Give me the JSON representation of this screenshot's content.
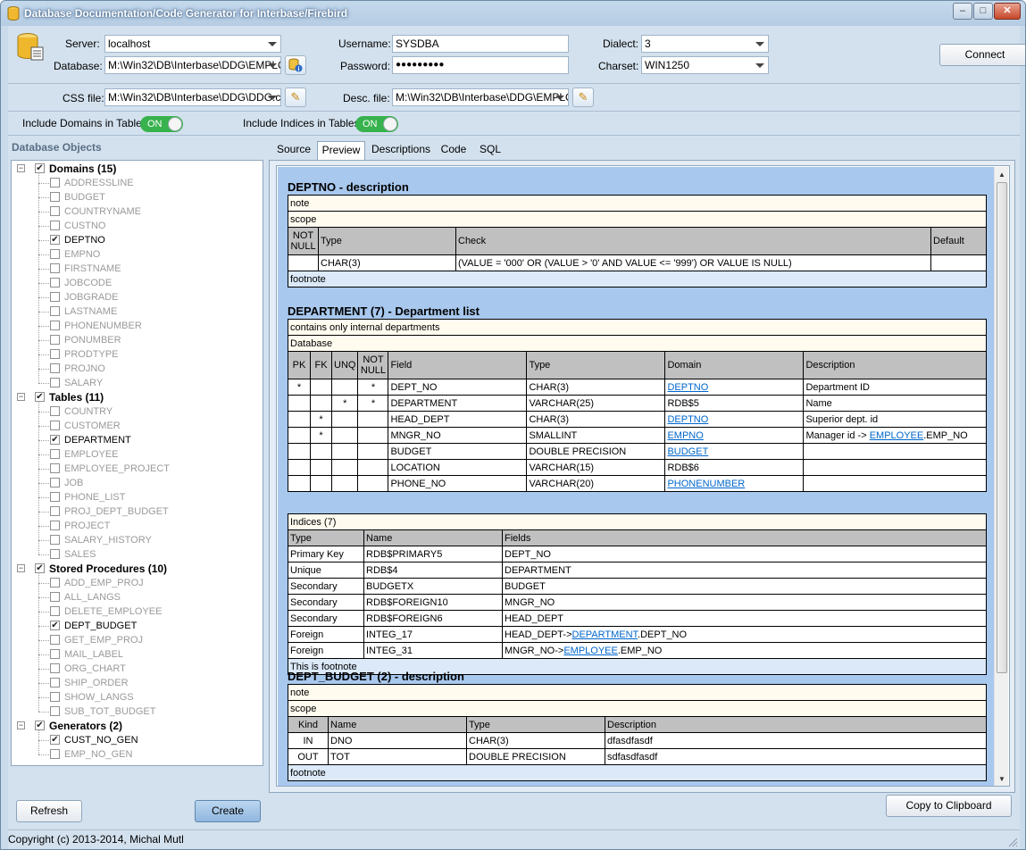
{
  "window": {
    "title": "Database Documentation/Code Generator for Interbase/Firebird",
    "min": "‒",
    "max": "□",
    "close": "✕"
  },
  "conn": {
    "server_label": "Server:",
    "server": "localhost",
    "database_label": "Database:",
    "database": "M:\\Win32\\DB\\Interbase\\DDG\\EMPLO'",
    "username_label": "Username:",
    "username": "SYSDBA",
    "password_label": "Password:",
    "password": "●●●●●●●●●",
    "dialect_label": "Dialect:",
    "dialect": "3",
    "charset_label": "Charset:",
    "charset": "WIN1250",
    "connect": "Connect"
  },
  "files": {
    "css_label": "CSS file:",
    "css": "M:\\Win32\\DB\\Interbase\\DDG\\DDG.cs",
    "desc_label": "Desc. file:",
    "desc": "M:\\Win32\\DB\\Interbase\\DDG\\EMPLO'"
  },
  "options": {
    "domains_label": "Include Domains in Tables",
    "domains_state": "ON",
    "indices_label": "Include Indices in Tables",
    "indices_state": "ON"
  },
  "objects_title": "Database Objects",
  "tree": [
    {
      "label": "Domains (15)",
      "checked": true,
      "items": [
        {
          "label": "ADDRESSLINE",
          "checked": false
        },
        {
          "label": "BUDGET",
          "checked": false
        },
        {
          "label": "COUNTRYNAME",
          "checked": false
        },
        {
          "label": "CUSTNO",
          "checked": false
        },
        {
          "label": "DEPTNO",
          "checked": true
        },
        {
          "label": "EMPNO",
          "checked": false
        },
        {
          "label": "FIRSTNAME",
          "checked": false
        },
        {
          "label": "JOBCODE",
          "checked": false
        },
        {
          "label": "JOBGRADE",
          "checked": false
        },
        {
          "label": "LASTNAME",
          "checked": false
        },
        {
          "label": "PHONENUMBER",
          "checked": false
        },
        {
          "label": "PONUMBER",
          "checked": false
        },
        {
          "label": "PRODTYPE",
          "checked": false
        },
        {
          "label": "PROJNO",
          "checked": false
        },
        {
          "label": "SALARY",
          "checked": false
        }
      ]
    },
    {
      "label": "Tables (11)",
      "checked": true,
      "items": [
        {
          "label": "COUNTRY",
          "checked": false
        },
        {
          "label": "CUSTOMER",
          "checked": false
        },
        {
          "label": "DEPARTMENT",
          "checked": true
        },
        {
          "label": "EMPLOYEE",
          "checked": false
        },
        {
          "label": "EMPLOYEE_PROJECT",
          "checked": false
        },
        {
          "label": "JOB",
          "checked": false
        },
        {
          "label": "PHONE_LIST",
          "checked": false
        },
        {
          "label": "PROJ_DEPT_BUDGET",
          "checked": false
        },
        {
          "label": "PROJECT",
          "checked": false
        },
        {
          "label": "SALARY_HISTORY",
          "checked": false
        },
        {
          "label": "SALES",
          "checked": false
        }
      ]
    },
    {
      "label": "Stored Procedures (10)",
      "checked": true,
      "items": [
        {
          "label": "ADD_EMP_PROJ",
          "checked": false
        },
        {
          "label": "ALL_LANGS",
          "checked": false
        },
        {
          "label": "DELETE_EMPLOYEE",
          "checked": false
        },
        {
          "label": "DEPT_BUDGET",
          "checked": true
        },
        {
          "label": "GET_EMP_PROJ",
          "checked": false
        },
        {
          "label": "MAIL_LABEL",
          "checked": false
        },
        {
          "label": "ORG_CHART",
          "checked": false
        },
        {
          "label": "SHIP_ORDER",
          "checked": false
        },
        {
          "label": "SHOW_LANGS",
          "checked": false
        },
        {
          "label": "SUB_TOT_BUDGET",
          "checked": false
        }
      ]
    },
    {
      "label": "Generators (2)",
      "checked": true,
      "items": [
        {
          "label": "CUST_NO_GEN",
          "checked": true
        },
        {
          "label": "EMP_NO_GEN",
          "checked": false
        }
      ]
    }
  ],
  "buttons": {
    "refresh": "Refresh",
    "create": "Create",
    "copy": "Copy to Clipboard"
  },
  "tabs": [
    "Source",
    "Preview",
    "Descriptions",
    "Code",
    "SQL"
  ],
  "doc": {
    "deptno": {
      "title": "DEPTNO - description",
      "note": "note",
      "scope": "scope",
      "headers": [
        "NOT NULL",
        "Type",
        "Check",
        "Default"
      ],
      "row": [
        "",
        "CHAR(3)",
        "(VALUE = '000' OR (VALUE > '0' AND VALUE <= '999') OR VALUE IS NULL)",
        ""
      ],
      "footnote": "footnote"
    },
    "department": {
      "title": "DEPARTMENT (7) - Department list",
      "note": "contains only internal departments",
      "scope": "Database",
      "headers": [
        "PK",
        "FK",
        "UNQ",
        "NOT NULL",
        "Field",
        "Type",
        "Domain",
        "Description"
      ],
      "rows": [
        {
          "pk": "*",
          "fk": "",
          "unq": "",
          "nn": "*",
          "field": "DEPT_NO",
          "type": "CHAR(3)",
          "domain": "DEPTNO",
          "domain_link": true,
          "desc": "Department ID"
        },
        {
          "pk": "",
          "fk": "",
          "unq": "*",
          "nn": "*",
          "field": "DEPARTMENT",
          "type": "VARCHAR(25)",
          "domain": "RDB$5",
          "domain_link": false,
          "desc": "Name"
        },
        {
          "pk": "",
          "fk": "*",
          "unq": "",
          "nn": "",
          "field": "HEAD_DEPT",
          "type": "CHAR(3)",
          "domain": "DEPTNO",
          "domain_link": true,
          "desc": "Superior dept. id"
        },
        {
          "pk": "",
          "fk": "*",
          "unq": "",
          "nn": "",
          "field": "MNGR_NO",
          "type": "SMALLINT",
          "domain": "EMPNO",
          "domain_link": true,
          "desc": "Manager id -> ",
          "desc_link": "EMPLOYEE",
          "desc_tail": ".EMP_NO"
        },
        {
          "pk": "",
          "fk": "",
          "unq": "",
          "nn": "",
          "field": "BUDGET",
          "type": "DOUBLE PRECISION",
          "domain": "BUDGET",
          "domain_link": true,
          "desc": ""
        },
        {
          "pk": "",
          "fk": "",
          "unq": "",
          "nn": "",
          "field": "LOCATION",
          "type": "VARCHAR(15)",
          "domain": "RDB$6",
          "domain_link": false,
          "desc": ""
        },
        {
          "pk": "",
          "fk": "",
          "unq": "",
          "nn": "",
          "field": "PHONE_NO",
          "type": "VARCHAR(20)",
          "domain": "PHONENUMBER",
          "domain_link": true,
          "desc": ""
        }
      ],
      "indices_label": "Indices (7)",
      "idx_headers": [
        "Type",
        "Name",
        "Fields"
      ],
      "indices": [
        {
          "type": "Primary Key",
          "name": "RDB$PRIMARY5",
          "fields": "DEPT_NO"
        },
        {
          "type": "Unique",
          "name": "RDB$4",
          "fields": "DEPARTMENT"
        },
        {
          "type": "Secondary",
          "name": "BUDGETX",
          "fields": "BUDGET"
        },
        {
          "type": "Secondary",
          "name": "RDB$FOREIGN10",
          "fields": "MNGR_NO"
        },
        {
          "type": "Secondary",
          "name": "RDB$FOREIGN6",
          "fields": "HEAD_DEPT"
        },
        {
          "type": "Foreign",
          "name": "INTEG_17",
          "fields": "HEAD_DEPT->",
          "fields_link": "DEPARTMENT",
          "fields_tail": ".DEPT_NO"
        },
        {
          "type": "Foreign",
          "name": "INTEG_31",
          "fields": "MNGR_NO->",
          "fields_link": "EMPLOYEE",
          "fields_tail": ".EMP_NO"
        }
      ],
      "footnote": "This is footnote"
    },
    "dept_budget": {
      "title": "DEPT_BUDGET (2) - description",
      "note": "note",
      "scope": "scope",
      "headers": [
        "Kind",
        "Name",
        "Type",
        "Description"
      ],
      "rows": [
        {
          "kind": "IN",
          "name": "DNO",
          "type": "CHAR(3)",
          "desc": "dfasdfasdf"
        },
        {
          "kind": "OUT",
          "name": "TOT",
          "type": "DOUBLE PRECISION",
          "desc": "sdfasdfasdf"
        }
      ],
      "footnote": "footnote"
    }
  },
  "status": "Copyright (c) 2013-2014, Michal Mutl"
}
